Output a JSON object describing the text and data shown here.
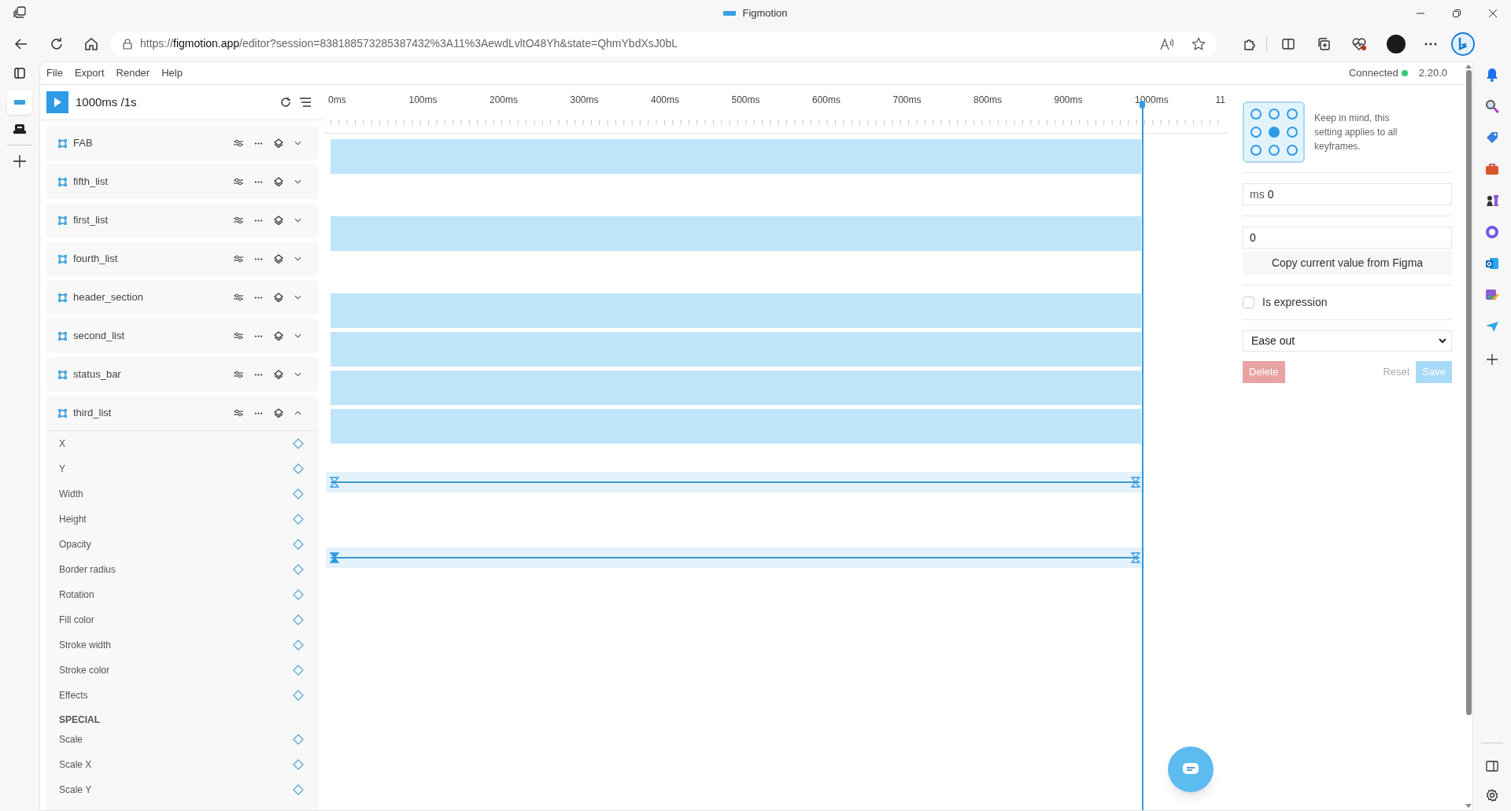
{
  "browser": {
    "title": "Figmotion",
    "url": {
      "scheme": "https://",
      "host": "figmotion.app",
      "path": "/editor?session=838188573285387432%3A11%3AewdLvltO48Yh&state=QhmYbdXsJ0bL"
    }
  },
  "menu": [
    "File",
    "Export",
    "Render",
    "Help"
  ],
  "connection": {
    "label": "Connected",
    "connected": true
  },
  "version": "2.20.0",
  "duration": "1000ms /1s",
  "ruler": [
    "0ms",
    "100ms",
    "200ms",
    "300ms",
    "400ms",
    "500ms",
    "600ms",
    "700ms",
    "800ms",
    "900ms",
    "1000ms",
    "11"
  ],
  "layers": [
    {
      "name": "FAB",
      "expanded": false,
      "has_track": true
    },
    {
      "name": "fifth_list",
      "expanded": false,
      "has_track": false
    },
    {
      "name": "first_list",
      "expanded": false,
      "has_track": true
    },
    {
      "name": "fourth_list",
      "expanded": false,
      "has_track": false
    },
    {
      "name": "header_section",
      "expanded": false,
      "has_track": true
    },
    {
      "name": "second_list",
      "expanded": false,
      "has_track": true
    },
    {
      "name": "status_bar",
      "expanded": false,
      "has_track": true
    },
    {
      "name": "third_list",
      "expanded": true,
      "has_track": true,
      "properties": [
        {
          "kind": "property",
          "label": "X"
        },
        {
          "kind": "property",
          "label": "Y",
          "keyframes": [
            {
              "selected": false
            },
            {
              "selected": false
            }
          ]
        },
        {
          "kind": "property",
          "label": "Width"
        },
        {
          "kind": "property",
          "label": "Height"
        },
        {
          "kind": "property",
          "label": "Opacity",
          "keyframes": [
            {
              "selected": true
            },
            {
              "selected": false
            }
          ]
        },
        {
          "kind": "property",
          "label": "Border radius"
        },
        {
          "kind": "property",
          "label": "Rotation"
        },
        {
          "kind": "property",
          "label": "Fill color"
        },
        {
          "kind": "property",
          "label": "Stroke width"
        },
        {
          "kind": "property",
          "label": "Stroke color"
        },
        {
          "kind": "property",
          "label": "Effects"
        },
        {
          "kind": "heading",
          "label": "SPECIAL"
        },
        {
          "kind": "property",
          "label": "Scale"
        },
        {
          "kind": "property",
          "label": "Scale X"
        },
        {
          "kind": "property",
          "label": "Scale Y"
        }
      ]
    }
  ],
  "inspector": {
    "anchors": [
      {
        "selected": false
      },
      {
        "selected": false
      },
      {
        "selected": false
      },
      {
        "selected": false
      },
      {
        "selected": true
      },
      {
        "selected": false
      },
      {
        "selected": false
      },
      {
        "selected": false
      },
      {
        "selected": false
      }
    ],
    "note": "Keep in mind, this setting applies to all keyframes.",
    "time_field": {
      "prefix": "ms",
      "value": "0"
    },
    "value_field": {
      "value": "0"
    },
    "copy_button": "Copy current value from Figma",
    "expression": {
      "label": "Is expression",
      "checked": false
    },
    "easing": "Ease out",
    "buttons": [
      {
        "kind": "danger",
        "label": "Delete",
        "disabled": true
      },
      {
        "kind": "plain",
        "label": "Reset",
        "disabled": true
      },
      {
        "kind": "primary",
        "label": "Save",
        "disabled": true
      }
    ]
  }
}
